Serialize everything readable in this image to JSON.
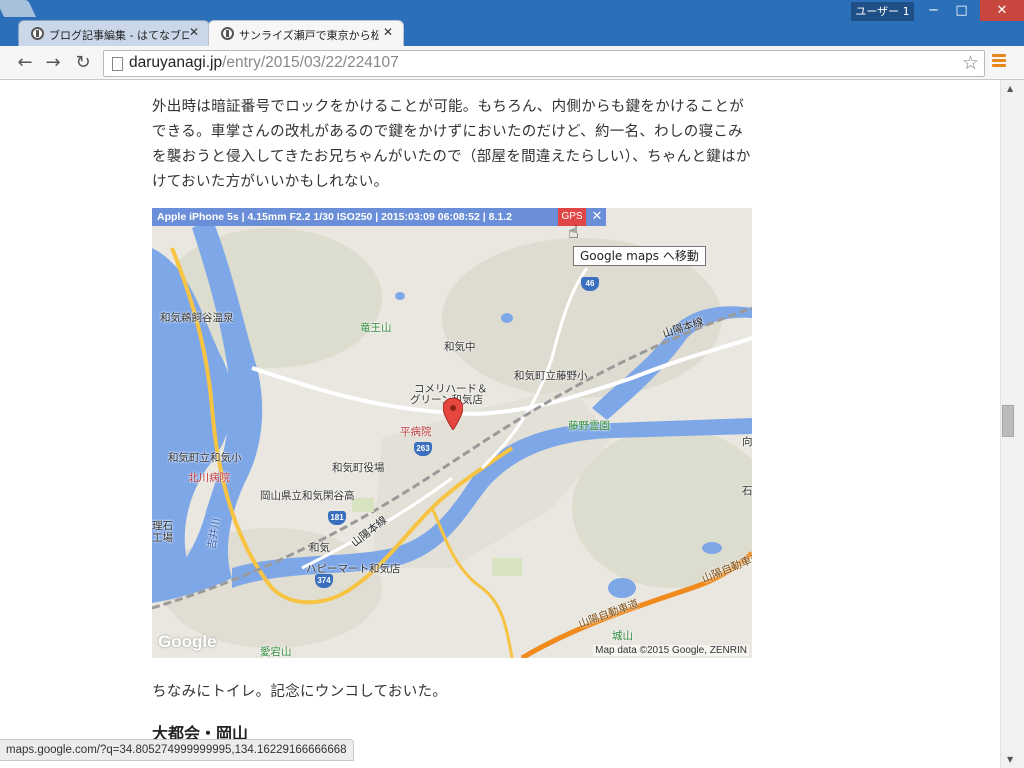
{
  "window": {
    "user_label": "ユーザー 1",
    "minimize": "−",
    "maximize": "□",
    "close": "✕"
  },
  "tabs": [
    {
      "title": "ブログ記事編集 - はてなブロ",
      "close": "✕",
      "active": false
    },
    {
      "title": "サンライズ瀬戸で東京から松山",
      "close": "✕",
      "active": true
    }
  ],
  "toolbar": {
    "back": "←",
    "forward": "→",
    "reload": "↻",
    "url_host": "daruyanagi.jp",
    "url_path": "/entry/2015/03/22/224107",
    "star": "☆"
  },
  "article": {
    "paragraph": "外出時は暗証番号でロックをかけることが可能。もちろん、内側からも鍵をかけることができる。車掌さんの改札があるので鍵をかけずにおいたのだけど、約一名、わしの寝こみを襲おうと侵入してきたお兄ちゃんがいたので（部屋を間違えたらしい）、ちゃんと鍵はかけておいた方がいいかもしれない。",
    "after_map": "ちなみにトイレ。記念にウンコしておいた。",
    "heading": "大都会・岡山"
  },
  "map": {
    "exif": "Apple iPhone 5s | 4.15mm F2.2 1/30 ISO250 | 2015:03:09 06:08:52 | 8.1.2",
    "gps_label": "GPS",
    "close_label": "✕",
    "tooltip": "Google maps へ移動",
    "attribution": "Map data ©2015 Google, ZENRIN",
    "logo": "Google",
    "labels": {
      "l1": "和気鵜飼谷温泉",
      "l2": "竜王山",
      "l3": "和気中",
      "l4": "コメリハード＆",
      "l5": "グリーン和気店",
      "l6": "和気町立藤野小",
      "l7": "山陽本線",
      "l8": "平病院",
      "l9": "藤野霊園",
      "l10": "和気町立和気小",
      "l11": "北川病院",
      "l12": "和気町役場",
      "l13": "岡山県立和気閑谷高",
      "l14": "理石",
      "l15": "工場",
      "l16": "吉井川",
      "l17": "和気",
      "l18": "山陽本線",
      "l19": "ハピーマート和気店",
      "l20": "山陽自動車道",
      "l21": "山陽自動車道",
      "l22": "城山",
      "l23": "愛宕山",
      "l24": "向",
      "l25": "石"
    },
    "shields": {
      "s46": "46",
      "s263": "263",
      "s181": "181",
      "s374": "374"
    }
  },
  "status_bar": {
    "url": "maps.google.com/?q=34.805274999999995,134.16229166666668"
  },
  "colors": {
    "titlebar": "#2a6fb8",
    "map_water": "#7ea7e8",
    "map_road": "#f6c343",
    "exif_bar": "#6a8ed8",
    "gps_button": "#e04646"
  }
}
